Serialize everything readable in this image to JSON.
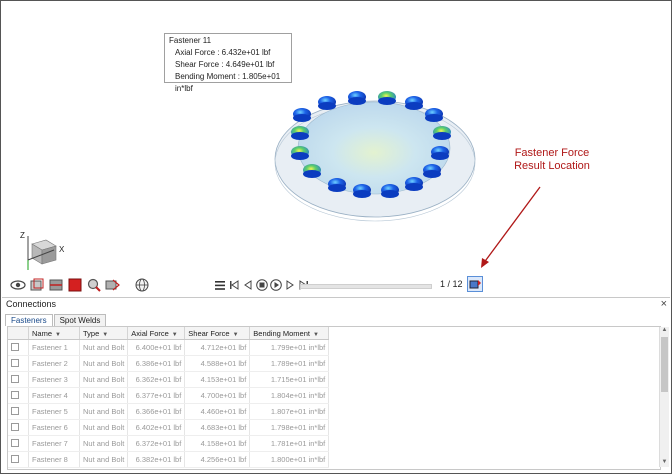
{
  "viewport": {
    "tooltip": {
      "title": "Fastener 11",
      "axial": "Axial Force : 6.432e+01 lbf",
      "shear": "Shear Force : 4.649e+01 lbf",
      "bending": "Bending Moment : 1.805e+01 in*lbf"
    },
    "annotation": {
      "line1": "Fastener Force",
      "line2": "Result Location"
    },
    "axis": {
      "z": "Z",
      "x": "X"
    },
    "frame_counter": "1 / 12",
    "colors": {
      "annotation": "#b01818",
      "arrow": "#b01818",
      "plate": "#cfe4f5"
    }
  },
  "panel": {
    "title": "Connections",
    "close": "×",
    "tabs": [
      {
        "label": "Fasteners"
      },
      {
        "label": "Spot Welds"
      }
    ],
    "columns": [
      "Name",
      "Type",
      "Axial Force",
      "Shear Force",
      "Bending Moment"
    ],
    "rows": [
      [
        "Fastener 1",
        "Nut and Bolt",
        "6.400e+01 lbf",
        "4.712e+01 lbf",
        "1.799e+01 in*lbf"
      ],
      [
        "Fastener 2",
        "Nut and Bolt",
        "6.386e+01 lbf",
        "4.588e+01 lbf",
        "1.789e+01 in*lbf"
      ],
      [
        "Fastener 3",
        "Nut and Bolt",
        "6.362e+01 lbf",
        "4.153e+01 lbf",
        "1.715e+01 in*lbf"
      ],
      [
        "Fastener 4",
        "Nut and Bolt",
        "6.377e+01 lbf",
        "4.700e+01 lbf",
        "1.804e+01 in*lbf"
      ],
      [
        "Fastener 5",
        "Nut and Bolt",
        "6.366e+01 lbf",
        "4.460e+01 lbf",
        "1.807e+01 in*lbf"
      ],
      [
        "Fastener 6",
        "Nut and Bolt",
        "6.402e+01 lbf",
        "4.683e+01 lbf",
        "1.798e+01 in*lbf"
      ],
      [
        "Fastener 7",
        "Nut and Bolt",
        "6.372e+01 lbf",
        "4.158e+01 lbf",
        "1.781e+01 in*lbf"
      ],
      [
        "Fastener 8",
        "Nut and Bolt",
        "6.382e+01 lbf",
        "4.256e+01 lbf",
        "1.800e+01 in*lbf"
      ]
    ]
  },
  "toolbar": {
    "icons": [
      "eye-icon",
      "wireframe-icon",
      "clip-icon",
      "stop-square-icon",
      "zoom-icon",
      "measure-icon",
      "globe-icon"
    ]
  },
  "player": {
    "icons": [
      "menu-icon",
      "first-frame-icon",
      "prev-frame-icon",
      "stop-icon",
      "play-icon",
      "next-frame-icon",
      "last-frame-icon"
    ]
  }
}
